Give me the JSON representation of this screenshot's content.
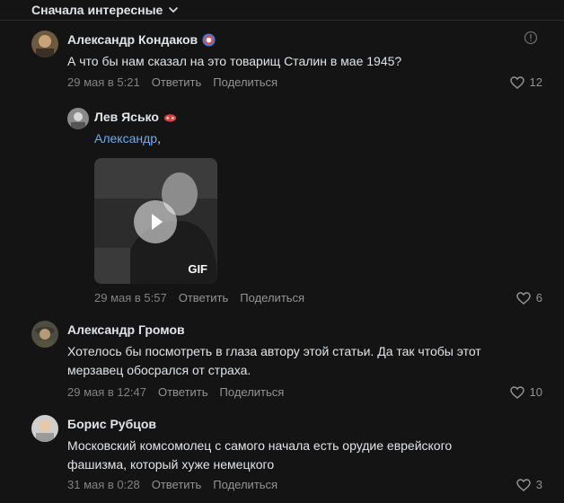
{
  "sort": {
    "label": "Сначала интересные"
  },
  "colors": {
    "background": "#141414",
    "text": "#e1e3e6",
    "muted": "#828282",
    "link": "#71aaeb"
  },
  "comments": [
    {
      "author": "Александр Кондаков",
      "text": "А что бы нам сказал на это товарищ Сталин в мае 1945?",
      "date": "29 мая в 5:21",
      "reply_label": "Ответить",
      "share_label": "Поделиться",
      "likes": "12"
    },
    {
      "author": "Лев Ясько",
      "mention": "Александр",
      "text_suffix": ",",
      "gif_label": "GIF",
      "date": "29 мая в 5:57",
      "reply_label": "Ответить",
      "share_label": "Поделиться",
      "likes": "6"
    },
    {
      "author": "Александр Громов",
      "text": "Хотелось бы посмотреть в глаза автору этой статьи. Да так чтобы этот\nмерзавец обосрался от страха.",
      "date": "29 мая в 12:47",
      "reply_label": "Ответить",
      "share_label": "Поделиться",
      "likes": "10"
    },
    {
      "author": "Борис Рубцов",
      "text": "Московский комсомолец с самого начала есть орудие еврейского\nфашизма, который хуже немецкого",
      "date": "31 мая в 0:28",
      "reply_label": "Ответить",
      "share_label": "Поделиться",
      "likes": "3"
    }
  ]
}
